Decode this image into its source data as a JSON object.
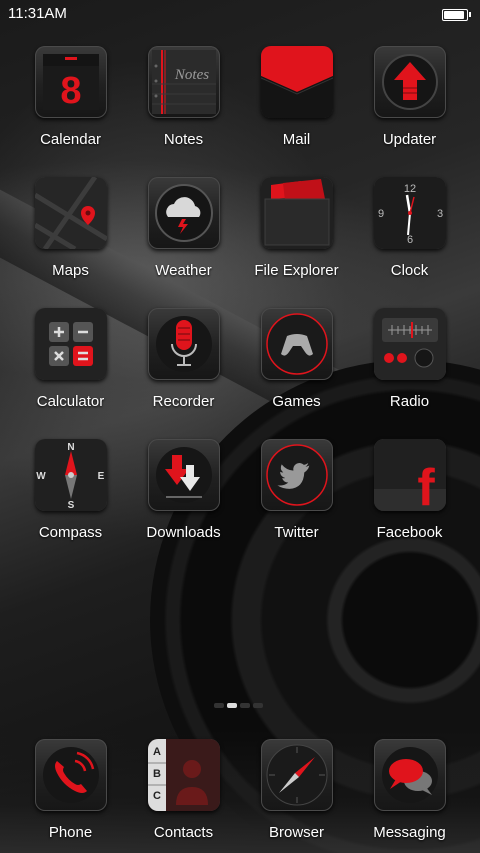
{
  "status": {
    "time": "11:31AM",
    "battery_level": 1.0
  },
  "apps": [
    {
      "label": "Calendar",
      "icon": "calendar-icon"
    },
    {
      "label": "Notes",
      "icon": "notes-icon",
      "icon_text": "Notes"
    },
    {
      "label": "Mail",
      "icon": "mail-icon"
    },
    {
      "label": "Updater",
      "icon": "updater-icon"
    },
    {
      "label": "Maps",
      "icon": "maps-icon"
    },
    {
      "label": "Weather",
      "icon": "weather-icon"
    },
    {
      "label": "File Explorer",
      "icon": "folder-icon"
    },
    {
      "label": "Clock",
      "icon": "clock-icon",
      "numerals": [
        "12",
        "3",
        "6",
        "9"
      ]
    },
    {
      "label": "Calculator",
      "icon": "calculator-icon"
    },
    {
      "label": "Recorder",
      "icon": "microphone-icon"
    },
    {
      "label": "Games",
      "icon": "gamepad-icon"
    },
    {
      "label": "Radio",
      "icon": "radio-icon"
    },
    {
      "label": "Compass",
      "icon": "compass-icon",
      "directions": [
        "N",
        "E",
        "S",
        "W"
      ]
    },
    {
      "label": "Downloads",
      "icon": "downloads-icon"
    },
    {
      "label": "Twitter",
      "icon": "twitter-icon"
    },
    {
      "label": "Facebook",
      "icon": "facebook-icon",
      "icon_text": "f"
    }
  ],
  "pager": {
    "pages": 4,
    "current": 2
  },
  "dock": [
    {
      "label": "Phone",
      "icon": "phone-icon"
    },
    {
      "label": "Contacts",
      "icon": "contacts-icon",
      "letters": [
        "A",
        "B",
        "C"
      ]
    },
    {
      "label": "Browser",
      "icon": "browser-icon"
    },
    {
      "label": "Messaging",
      "icon": "messaging-icon"
    }
  ],
  "colors": {
    "accent": "#e0141c",
    "icon_bg": "#222222",
    "label": "#ffffff"
  }
}
